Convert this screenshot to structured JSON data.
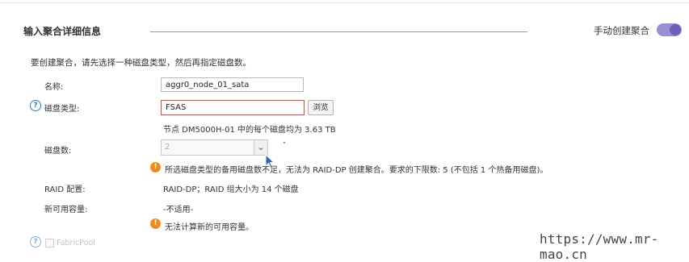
{
  "header": {
    "title": "输入聚合详细信息",
    "toggle_label": "手动创建聚合",
    "toggle_on": true
  },
  "intro": "要创建聚合，请先选择一种磁盘类型，然后再指定磁盘数。",
  "form": {
    "name_label": "名称:",
    "name_value": "aggr0_node_01_sata",
    "disk_type_label": "磁盘类型:",
    "disk_type_value": "FSAS",
    "browse_label": "浏览",
    "disk_type_note": "节点 DM5000H-01 中的每个磁盘均为 3.63 TB",
    "disk_count_label": "磁盘数:",
    "disk_count_value": "2",
    "disk_count_warning": "所选磁盘类型的备用磁盘数不足，无法为 RAID-DP 创建聚合。要求的下限数: 5 (不包括 1 个热备用磁盘)。",
    "raid_label": "RAID 配置:",
    "raid_value": "RAID-DP；RAID 组大小为 14 个磁盘",
    "capacity_label": "新可用容量:",
    "capacity_value": "-不适用-",
    "capacity_warning": "无法计算新的可用容量。",
    "fabricpool_label": "FabricPool"
  },
  "watermark": "https://www.mr-mao.cn",
  "colors": {
    "toggle_track": "#9b8ed3",
    "toggle_knob": "#6f5fb8",
    "help_icon": "#2f7dc1",
    "warning_icon": "#f08a1c",
    "error_border": "#d64b3b"
  }
}
